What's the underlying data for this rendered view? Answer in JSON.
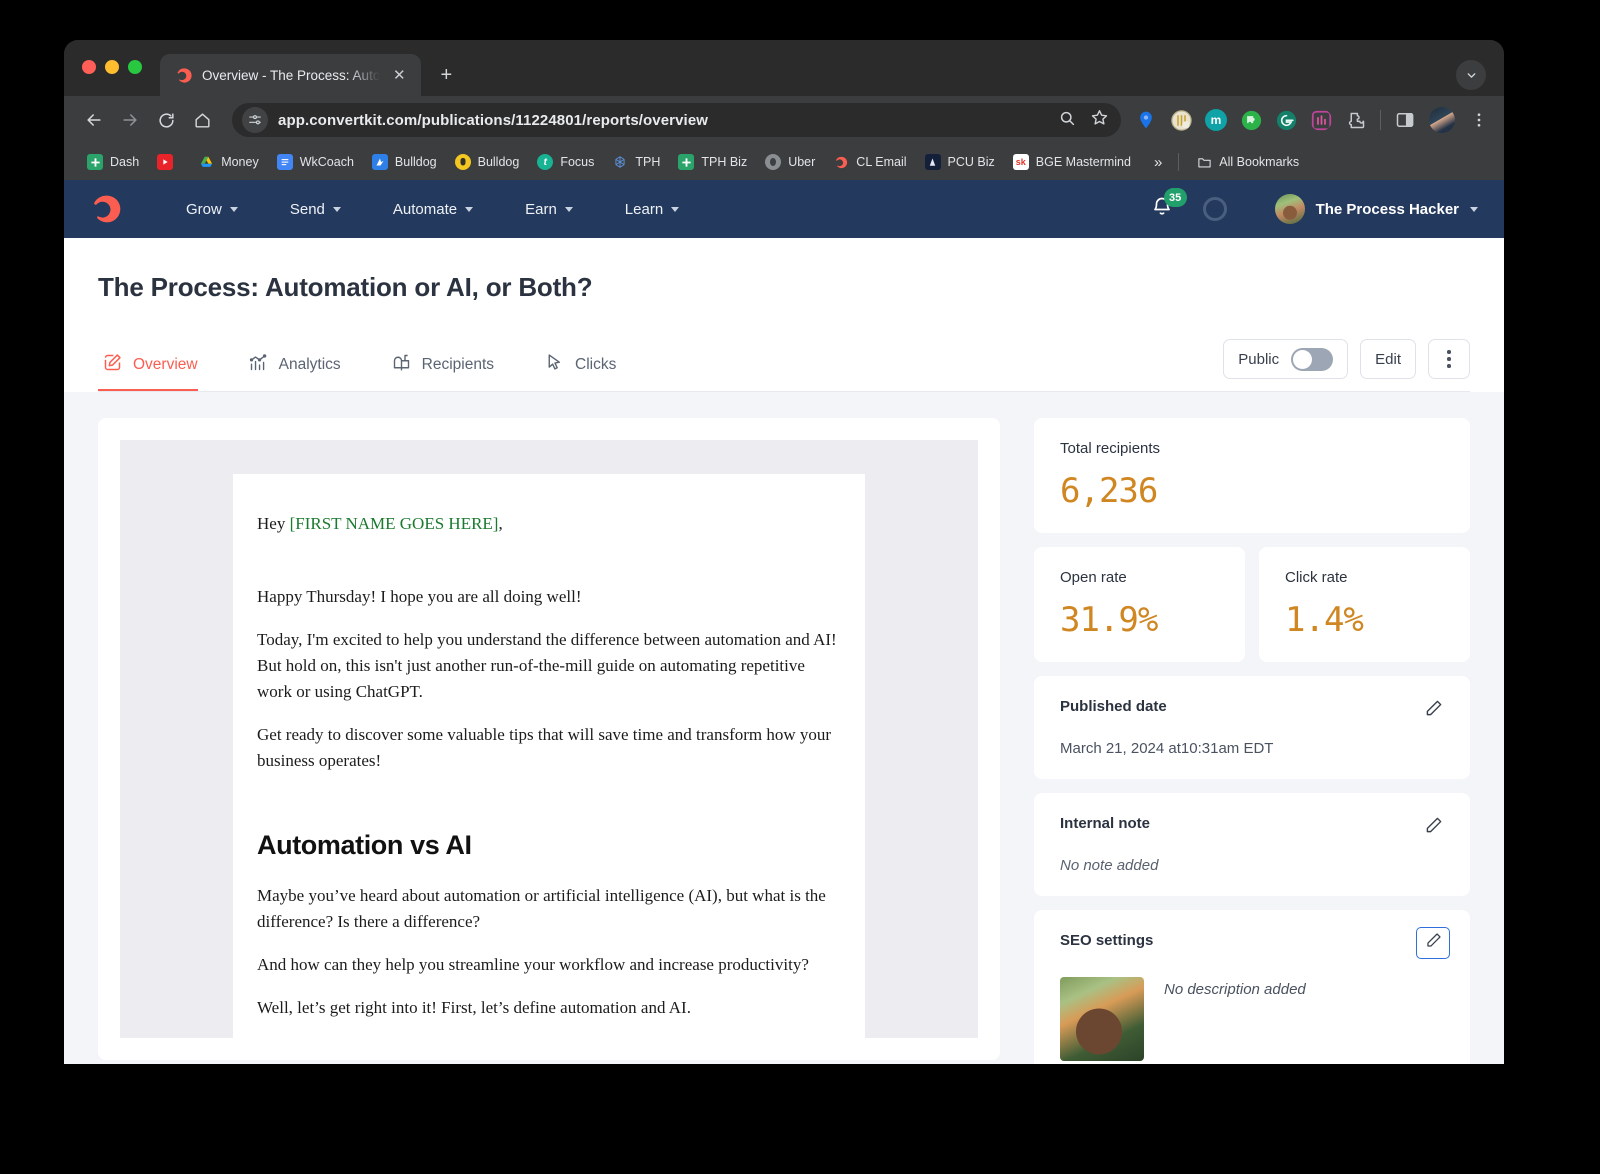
{
  "browser": {
    "tab": {
      "title": "Overview - The Process: Auto",
      "favicon": "convertkit-icon",
      "close_label": "✕"
    },
    "newtab_label": "+",
    "url": "app.convertkit.com/publications/11224801/reports/overview",
    "nav": {
      "back": "back-icon",
      "forward": "forward-icon",
      "reload": "reload-icon",
      "home": "home-icon"
    },
    "omnibox_icons": [
      "site-settings-icon",
      "search-icon",
      "bookmark-star-icon"
    ],
    "extensions": [
      "pin-extension-icon",
      "badge-extension-icon",
      "mastodon-extension-icon",
      "puzzle-green-extension-icon",
      "grammarly-extension-icon",
      "bars-extension-icon",
      "extensions-puzzle-icon"
    ],
    "side_panel": "side-panel-icon",
    "menu": "chrome-menu-icon",
    "bookmarks": [
      {
        "label": "Dash",
        "icon": "dash-icon"
      },
      {
        "label": "",
        "icon": "youtube-icon"
      },
      {
        "label": "Money",
        "icon": "google-drive-icon"
      },
      {
        "label": "WkCoach",
        "icon": "google-docs-icon"
      },
      {
        "label": "Bulldog",
        "icon": "blue-bulldog-icon"
      },
      {
        "label": "Bulldog",
        "icon": "crest-bulldog-icon"
      },
      {
        "label": "Focus",
        "icon": "toggl-icon"
      },
      {
        "label": "TPH",
        "icon": "tph-icon"
      },
      {
        "label": "TPH Biz",
        "icon": "sheets-icon"
      },
      {
        "label": "Uber",
        "icon": "uber-face-icon"
      },
      {
        "label": "CL Email",
        "icon": "convertkit-icon"
      },
      {
        "label": "PCU Biz",
        "icon": "pcu-icon"
      },
      {
        "label": "BGE Mastermind",
        "icon": "sk-icon"
      }
    ],
    "bookmarks_overflow": "»",
    "all_bookmarks": {
      "label": "All Bookmarks",
      "icon": "folder-icon"
    }
  },
  "appnav": {
    "logo": "convertkit-logo",
    "links": [
      {
        "label": "Grow"
      },
      {
        "label": "Send"
      },
      {
        "label": "Automate"
      },
      {
        "label": "Earn"
      },
      {
        "label": "Learn"
      }
    ],
    "notifications": {
      "icon": "bell-icon",
      "count": "35",
      "badge_color": "#22a06b"
    },
    "status_ring": "progress-ring-icon",
    "user": {
      "name": "The Process Hacker",
      "avatar": "user-avatar"
    }
  },
  "page": {
    "title": "The Process: Automation or AI, or Both?",
    "tabs": [
      {
        "label": "Overview",
        "icon": "pencil-square-icon",
        "active": true
      },
      {
        "label": "Analytics",
        "icon": "bar-chart-icon",
        "active": false
      },
      {
        "label": "Recipients",
        "icon": "mailbox-icon",
        "active": false
      },
      {
        "label": "Clicks",
        "icon": "cursor-arrow-icon",
        "active": false
      }
    ],
    "actions": {
      "public_label": "Public",
      "public_on": false,
      "edit_label": "Edit",
      "more_label": "more-options"
    },
    "accent_color": "#fb5d50"
  },
  "email": {
    "greeting_prefix": "Hey ",
    "merge_tag": "[FIRST NAME GOES HERE]",
    "greeting_suffix": ",",
    "merge_color": "#1a7a2e",
    "paragraphs": [
      "Happy Thursday! I hope you are all doing well!",
      "Today, I'm excited to help you understand the difference between automation and AI! But hold on, this isn't just another run-of-the-mill guide on automating repetitive work or using ChatGPT.",
      "Get ready to discover some valuable tips that will save time and transform how your business operates!"
    ],
    "heading": "Automation vs AI",
    "paragraphs2": [
      "Maybe you’ve heard about automation or artificial intelligence (AI), but what is the difference? Is there a difference?",
      "And how can they help you streamline your workflow and increase productivity?",
      "Well, let’s get right into it! First, let’s define automation and AI."
    ]
  },
  "sidebar": {
    "stat_color": "#d08621",
    "total_recipients": {
      "label": "Total recipients",
      "value": "6,236"
    },
    "open_rate": {
      "label": "Open rate",
      "value": "31.9%"
    },
    "click_rate": {
      "label": "Click rate",
      "value": "1.4%"
    },
    "published_date": {
      "label": "Published date",
      "value": "March 21, 2024 at10:31am EDT",
      "edit": "edit-pencil-icon"
    },
    "internal_note": {
      "label": "Internal note",
      "value": "No note added",
      "edit": "edit-pencil-icon"
    },
    "seo": {
      "label": "SEO settings",
      "description": "No description added",
      "edit": "edit-pencil-icon",
      "thumbnail": "seo-thumbnail"
    }
  }
}
